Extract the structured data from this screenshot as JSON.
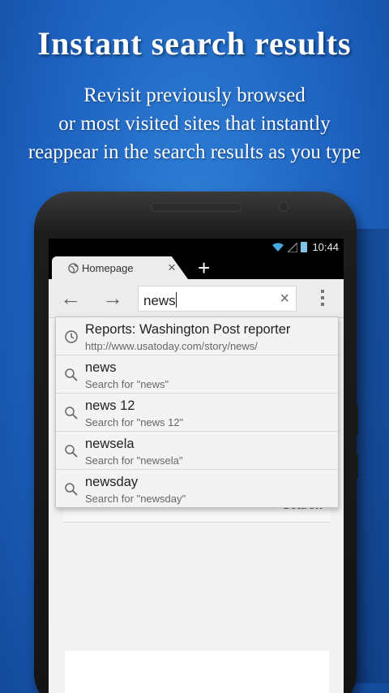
{
  "promo": {
    "headline": "Instant search results",
    "line1": "Revisit previously browsed",
    "line2": "or most visited sites that instantly",
    "line3": "reappear in the search results as you type"
  },
  "status_bar": {
    "time": "10:44",
    "icons": [
      "wifi-icon",
      "signal-icon",
      "battery-icon"
    ]
  },
  "tab": {
    "title": "Homepage",
    "close_symbol": "×",
    "new_tab_symbol": "+"
  },
  "toolbar": {
    "back_symbol": "←",
    "forward_symbol": "→",
    "url_value": "news",
    "clear_symbol": "×"
  },
  "page": {
    "search_button_label": "Search"
  },
  "suggestions": [
    {
      "icon": "history-clock-icon",
      "title": "Reports: Washington Post reporter",
      "subtitle": "http://www.usatoday.com/story/news/"
    },
    {
      "icon": "search-icon",
      "title": "news",
      "subtitle": "Search for \"news\""
    },
    {
      "icon": "search-icon",
      "title": "news 12",
      "subtitle": "Search for \"news 12\""
    },
    {
      "icon": "search-icon",
      "title": "newsela",
      "subtitle": "Search for \"newsela\""
    },
    {
      "icon": "search-icon",
      "title": "newsday",
      "subtitle": "Search for \"newsday\""
    }
  ],
  "colors": {
    "background": "#1d62c0",
    "phone_body": "#1c1c1c",
    "toolbar": "#ececec"
  }
}
